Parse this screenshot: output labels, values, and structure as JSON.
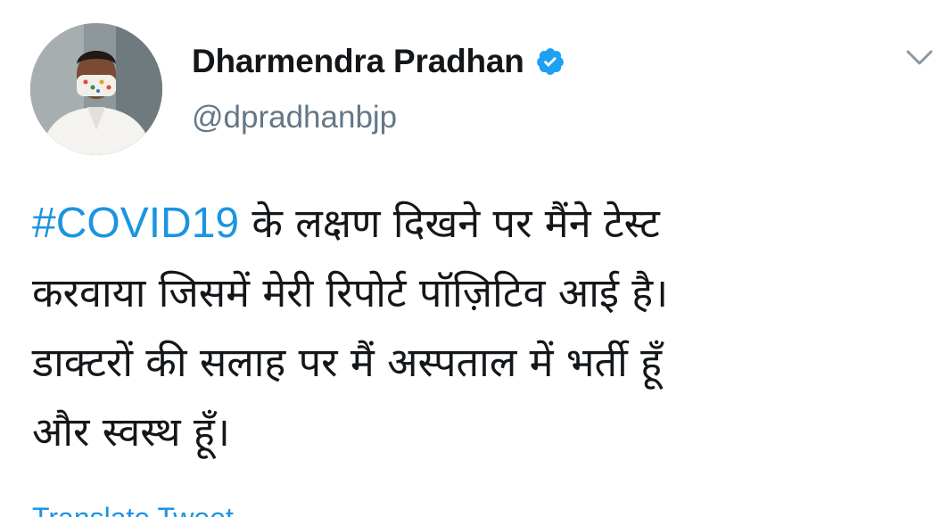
{
  "tweet": {
    "author": {
      "display_name": "Dharmendra Pradhan",
      "handle": "@dpradhanbjp",
      "verified": true
    },
    "icons": {
      "avatar": "profile-photo-avatar",
      "verified": "verified-badge-icon",
      "menu": "chevron-down-icon"
    },
    "text": {
      "hashtag": "#COVID19",
      "line1_rest": " के लक्षण दिखने पर मैंने टेस्ट",
      "line2": "करवाया जिसमें मेरी रिपोर्ट पॉज़िटिव आई है।",
      "line3": "डाक्टरों की सलाह पर मैं अस्पताल में भर्ती हूँ",
      "line4": "और स्वस्थ हूँ।"
    },
    "translate_label": "Translate Tweet"
  },
  "colors": {
    "link": "#1b95e0",
    "verified_badge": "#1da1f2",
    "secondary_text": "#657786",
    "primary_text": "#14171a"
  }
}
